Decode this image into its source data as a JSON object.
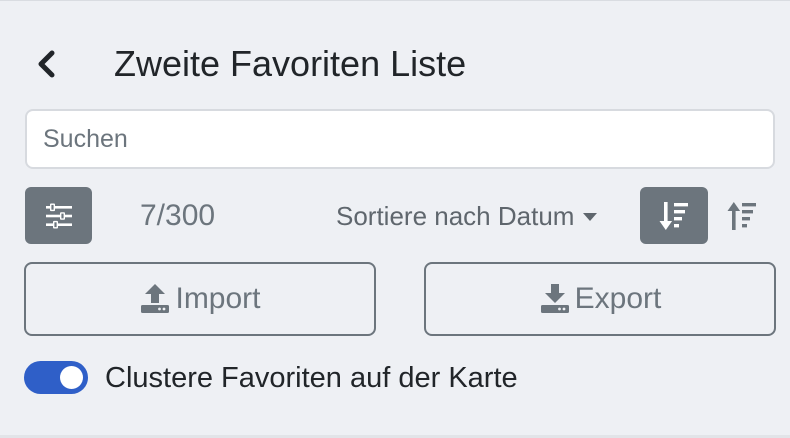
{
  "header": {
    "back_icon": "chevron-left-icon",
    "title": "Zweite Favoriten Liste"
  },
  "search": {
    "value": "",
    "placeholder": "Suchen"
  },
  "toolbar": {
    "filter_icon": "sliders-icon",
    "count": "7/300",
    "sort_label": "Sortiere nach Datum",
    "sort_desc_icon": "sort-descending-icon",
    "sort_asc_icon": "sort-ascending-icon",
    "active_sort": "descending"
  },
  "actions": {
    "import_label": "Import",
    "import_icon": "upload-icon",
    "export_label": "Export",
    "export_icon": "download-icon"
  },
  "cluster_toggle": {
    "label": "Clustere Favoriten auf der Karte",
    "checked": true
  },
  "colors": {
    "accent": "#2f5fc8",
    "secondary": "#6c757d",
    "background": "#eef0f4",
    "text": "#212529"
  }
}
